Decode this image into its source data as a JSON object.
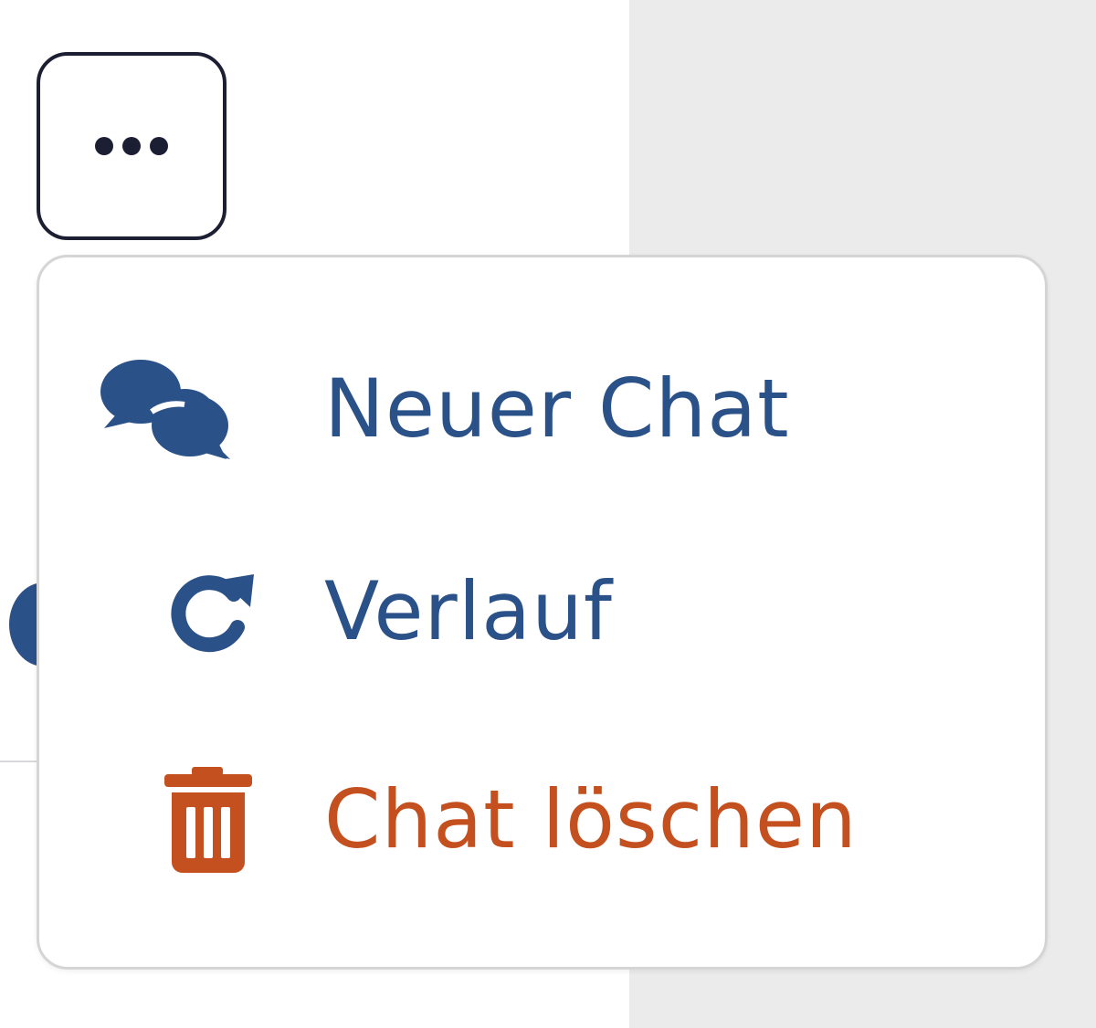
{
  "more_button": {
    "icon": "ellipsis-horizontal-icon"
  },
  "menu": {
    "items": [
      {
        "label": "Neuer Chat",
        "icon": "chat-bubbles-icon",
        "color": "#2b5189"
      },
      {
        "label": "Verlauf",
        "icon": "history-icon",
        "color": "#2b5189"
      },
      {
        "label": "Chat löschen",
        "icon": "trash-icon",
        "color": "#c5501f"
      }
    ]
  },
  "colors": {
    "primary": "#2b5189",
    "danger": "#c5501f",
    "button_border": "#1c1f33",
    "background_right": "#ebebeb"
  }
}
